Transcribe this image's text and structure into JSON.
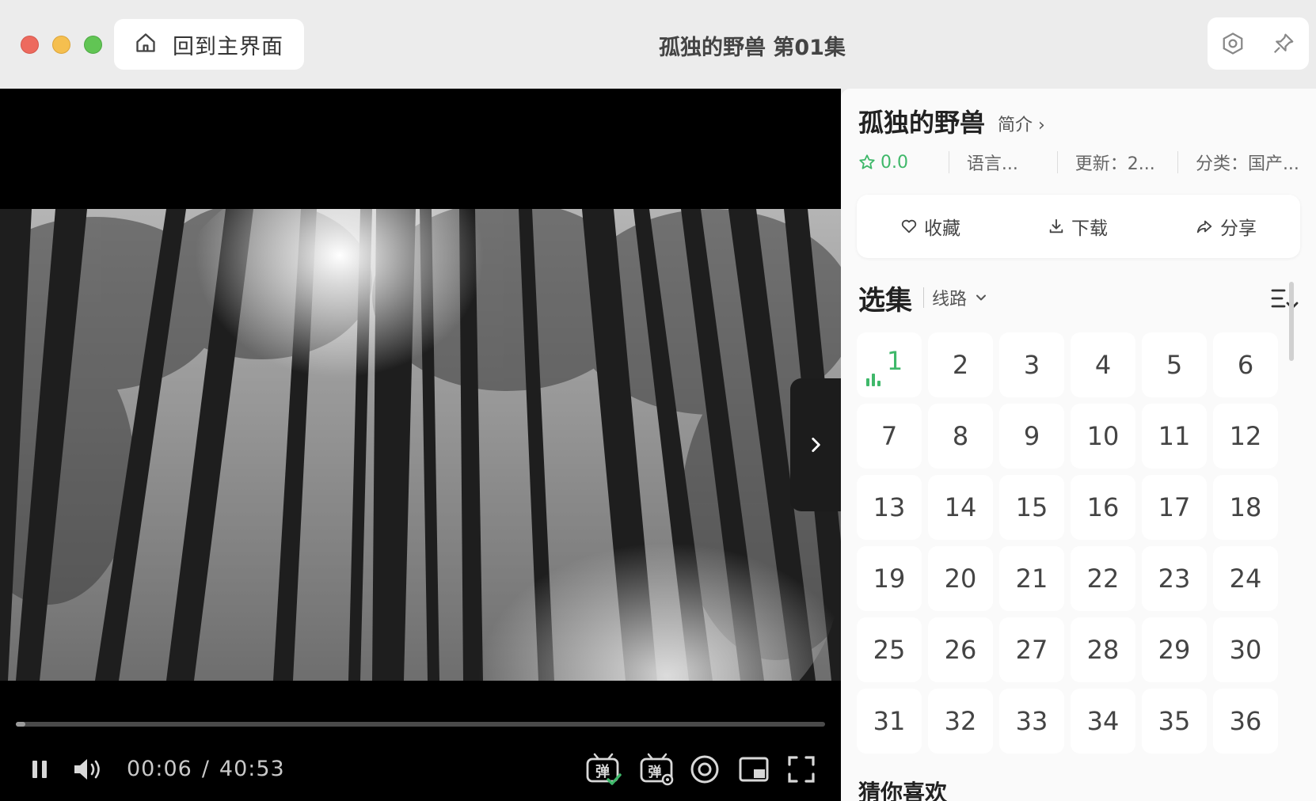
{
  "window": {
    "title": "孤独的野兽 第01集",
    "home_label": "回到主界面"
  },
  "player": {
    "current_time": "00:06",
    "separator": "/",
    "duration": "40:53",
    "progress": 0.003,
    "is_playing": true
  },
  "detail": {
    "title": "孤独的野兽",
    "intro_label": "简介 ›",
    "rating": "0.0",
    "language": "语言...",
    "updated": "更新：2...",
    "category": "分类：国产..."
  },
  "actions": {
    "favorite": "收藏",
    "download": "下载",
    "share": "分享"
  },
  "episodes": {
    "heading": "选集",
    "line_label": "线路",
    "current": 1,
    "items": [
      "1",
      "2",
      "3",
      "4",
      "5",
      "6",
      "7",
      "8",
      "9",
      "10",
      "11",
      "12",
      "13",
      "14",
      "15",
      "16",
      "17",
      "18",
      "19",
      "20",
      "21",
      "22",
      "23",
      "24",
      "25",
      "26",
      "27",
      "28",
      "29",
      "30",
      "31",
      "32",
      "33",
      "34",
      "35",
      "36"
    ]
  },
  "recommend": {
    "heading": "猜你喜欢"
  },
  "colors": {
    "accent": "#3fb86a",
    "player_bg": "#000000",
    "panel_bg": "#fafafa"
  }
}
